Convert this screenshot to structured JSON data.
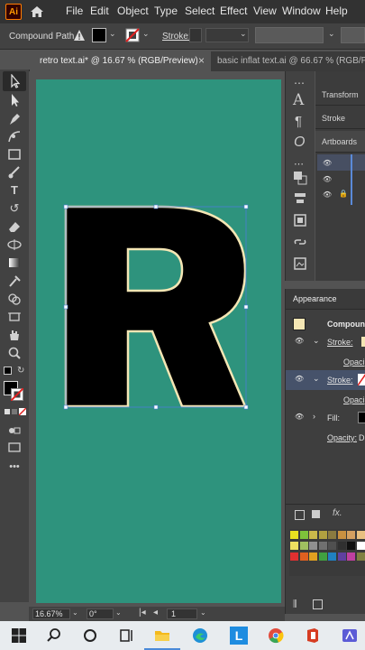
{
  "menubar": {
    "logo": "Ai",
    "items": [
      "File",
      "Edit",
      "Object",
      "Type",
      "Select",
      "Effect",
      "View",
      "Window",
      "Help"
    ]
  },
  "control": {
    "selection_type": "Compound Path",
    "stroke_label": "Stroke:"
  },
  "tabs": [
    {
      "label": "retro text.ai* @ 16.67 % (RGB/Preview)",
      "close": "×"
    },
    {
      "label": "basic inflat text.ai @ 66.67 % (RGB/P"
    }
  ],
  "artwork": {
    "letter": "R",
    "artboard_color": "#2e937d",
    "fill_color": "#000000",
    "stroke_color": "#f4e6b4"
  },
  "panels": {
    "transform": "Transform",
    "stroke": "Stroke",
    "artboards": "Artboards",
    "appearance_tab": "Appearance",
    "appearance_header": "Compound",
    "rows": [
      {
        "label": "Stroke:",
        "type": "stroke"
      },
      {
        "label": "Opaci",
        "type": "opacity"
      },
      {
        "label": "Stroke:",
        "type": "stroke-selected"
      },
      {
        "label": "Opaci",
        "type": "opacity"
      },
      {
        "label": "Fill:",
        "type": "fill"
      },
      {
        "label": "Opacity:",
        "value": "D",
        "type": "opacity-main"
      }
    ],
    "fx": "fx."
  },
  "status": {
    "zoom": "16.67%",
    "rotation": "0°",
    "artboard_num": "1"
  }
}
